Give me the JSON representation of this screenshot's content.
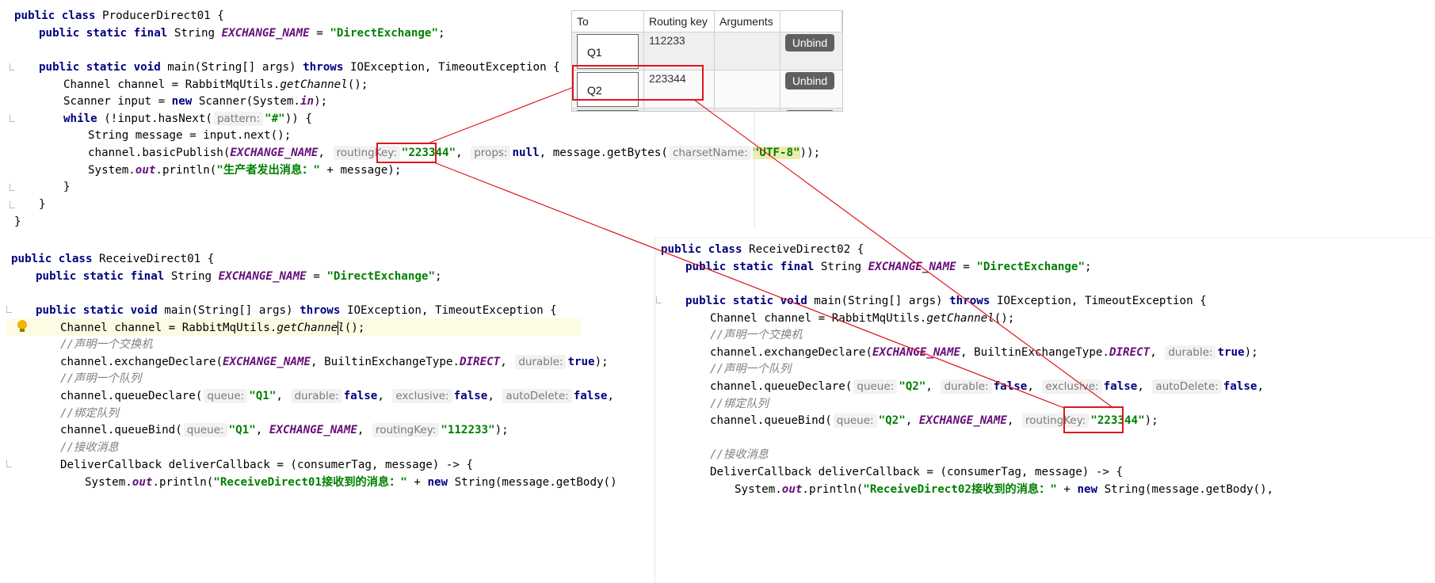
{
  "producer": {
    "line1": {
      "kw": "public class",
      "name": "ProducerDirect01 {"
    },
    "line2": {
      "kw": "public static final",
      "type": "String",
      "field": "EXCHANGE_NAME",
      "eq": "=",
      "str": "\"DirectExchange\"",
      "end": ";"
    },
    "line3": {
      "kw1": "public static void",
      "sig": "main(String[] args)",
      "kw2": "throws",
      "rest": "IOException, TimeoutException {"
    },
    "line4": {
      "a": "Channel channel = RabbitMqUtils.",
      "b": "getChannel",
      "c": "();"
    },
    "line5": {
      "a": "Scanner input = ",
      "kw": "new",
      "b": "Scanner(System.",
      "c": "in",
      "d": ");"
    },
    "line6": {
      "kw": "while",
      "a": "(!input.hasNext(",
      "hint": "pattern:",
      "str": "\"#\"",
      "b": ")) {"
    },
    "line7": "String message = input.next();",
    "line8": {
      "a": "channel.basicPublish(",
      "field": "EXCHANGE_NAME",
      "b": ",",
      "hint1": "routingKey:",
      "key": "\"223344\"",
      "c": ",",
      "hint2": "props:",
      "kw": "null",
      "d": ", message.getBytes(",
      "hint3": "charsetName:",
      "str": "\"UTF-8\"",
      "e": "));"
    },
    "line9": {
      "a": "System.",
      "field": "out",
      "b": ".println(",
      "str": "\"生产者发出消息：\"",
      "c": " + message);"
    },
    "line10": "}",
    "line11": "}",
    "line12": "}"
  },
  "receiver1": {
    "line1": {
      "kw": "public class",
      "name": "ReceiveDirect01 {"
    },
    "line2": {
      "kw": "public static final",
      "type": "String",
      "field": "EXCHANGE_NAME",
      "eq": "=",
      "str": "\"DirectExchange\"",
      "end": ";"
    },
    "line3": {
      "kw1": "public static void",
      "sig": "main(String[] args)",
      "kw2": "throws",
      "rest": "IOException, TimeoutException {"
    },
    "line4": {
      "a": "Channel channel = RabbitMqUtils.",
      "b": "getChannel",
      "c": "();"
    },
    "line5": "//声明一个交换机",
    "line6": {
      "a": "channel.exchangeDeclare(",
      "field": "EXCHANGE_NAME",
      "b": ", BuiltinExchangeType.",
      "c": "DIRECT",
      "d": ",",
      "hint": "durable:",
      "kw": "true",
      "e": ");"
    },
    "line7": "//声明一个队列",
    "line8": {
      "a": "channel.queueDeclare(",
      "h1": "queue:",
      "s1": "\"Q1\"",
      "h2": "durable:",
      "k2": "false",
      "h3": "exclusive:",
      "k3": "false",
      "h4": "autoDelete:",
      "k4": "false"
    },
    "line9": "//绑定队列",
    "line10": {
      "a": "channel.queueBind(",
      "h1": "queue:",
      "s1": "\"Q1\"",
      "field": "EXCHANGE_NAME",
      "h2": "routingKey:",
      "s2": "\"112233\"",
      "e": ");"
    },
    "line11": "//接收消息",
    "line12": {
      "a": "DeliverCallback deliverCallback = (consumerTag, message) -> {"
    },
    "line13": {
      "a": "System.",
      "field": "out",
      "b": ".println(",
      "str": "\"ReceiveDirect01接收到的消息：\"",
      "c": " + ",
      "kw": "new",
      "d": " String(message.getBody()"
    }
  },
  "receiver2": {
    "line1": {
      "kw": "public class",
      "name": "ReceiveDirect02 {"
    },
    "line2": {
      "kw": "public static final",
      "type": "String",
      "field": "EXCHANGE_NAME",
      "eq": "=",
      "str": "\"DirectExchange\"",
      "end": ";"
    },
    "line3": {
      "kw1": "public static void",
      "sig": "main(String[] args)",
      "kw2": "throws",
      "rest": "IOException, TimeoutException {"
    },
    "line4": {
      "a": "Channel channel = RabbitMqUtils.",
      "b": "getChannel",
      "c": "();"
    },
    "line5": "//声明一个交换机",
    "line6": {
      "a": "channel.exchangeDeclare(",
      "field": "EXCHANGE_NAME",
      "b": ", BuiltinExchangeType.",
      "c": "DIRECT",
      "d": ",",
      "hint": "durable:",
      "kw": "true",
      "e": ");"
    },
    "line7": "//声明一个队列",
    "line8": {
      "a": "channel.queueDeclare(",
      "h1": "queue:",
      "s1": "\"Q2\"",
      "h2": "durable:",
      "k2": "false",
      "h3": "exclusive:",
      "k3": "false",
      "h4": "autoDelete:",
      "k4": "false"
    },
    "line9": "//绑定队列",
    "line10": {
      "a": "channel.queueBind(",
      "h1": "queue:",
      "s1": "\"Q2\"",
      "field": "EXCHANGE_NAME",
      "h2": "routingKey:",
      "s2": "\"223344\"",
      "e": ");"
    },
    "line11": "//接收消息",
    "line12": {
      "a": "DeliverCallback deliverCallback = (consumerTag, message) -> {"
    },
    "line13": {
      "a": "System.",
      "field": "out",
      "b": ".println(",
      "str": "\"ReceiveDirect02接收到的消息：\"",
      "c": " + ",
      "kw": "new",
      "d": " String(message.getBody(),"
    }
  },
  "bindings": {
    "headers": {
      "to": "To",
      "routing_key": "Routing key",
      "arguments": "Arguments"
    },
    "rows": [
      {
        "to": "Q1",
        "routing_key": "112233",
        "action": "Unbind"
      },
      {
        "to": "Q2",
        "routing_key": "223344",
        "action": "Unbind"
      }
    ]
  },
  "colors": {
    "highlight_box": "#e0161d",
    "connector": "#e0161d",
    "keyword": "#000080",
    "string": "#008000",
    "field": "#660e7a"
  }
}
